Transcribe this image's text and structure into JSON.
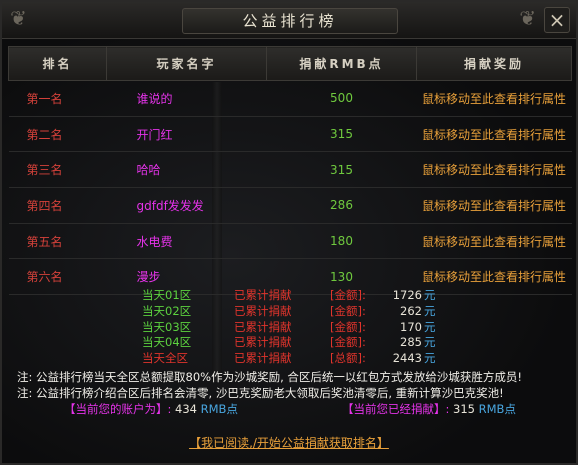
{
  "window": {
    "title": "公益排行榜",
    "close_glyph": "×"
  },
  "table": {
    "headers": [
      "排名",
      "玩家名字",
      "捐献RMB点",
      "捐献奖励"
    ],
    "rows": [
      {
        "rank": "第一名",
        "name": "谁说的",
        "points": "500",
        "reward": "鼠标移动至此查看排行属性"
      },
      {
        "rank": "第二名",
        "name": "开门红",
        "points": "315",
        "reward": "鼠标移动至此查看排行属性"
      },
      {
        "rank": "第三名",
        "name": "哈哈",
        "points": "315",
        "reward": "鼠标移动至此查看排行属性"
      },
      {
        "rank": "第四名",
        "name": "gdfdf发发发",
        "points": "286",
        "reward": "鼠标移动至此查看排行属性"
      },
      {
        "rank": "第五名",
        "name": "水电费",
        "points": "180",
        "reward": "鼠标移动至此查看排行属性"
      },
      {
        "rank": "第六名",
        "name": "漫步",
        "points": "130",
        "reward": "鼠标移动至此查看排行属性"
      }
    ]
  },
  "summary": [
    {
      "day": "当天01区",
      "label": "已累计捐献",
      "amount_label": "[金额]:",
      "value": "1726",
      "unit": "元"
    },
    {
      "day": "当天02区",
      "label": "已累计捐献",
      "amount_label": "[金额]:",
      "value": "262",
      "unit": "元"
    },
    {
      "day": "当天03区",
      "label": "已累计捐献",
      "amount_label": "[金额]:",
      "value": "170",
      "unit": "元"
    },
    {
      "day": "当天04区",
      "label": "已累计捐献",
      "amount_label": "[金额]:",
      "value": "285",
      "unit": "元"
    },
    {
      "day": "当天全区",
      "label": "已累计捐献",
      "amount_label": "[总额]:",
      "value": "2443",
      "unit": "元"
    }
  ],
  "notes": [
    "注: 公益排行榜当天全区总额提取80%作为沙城奖励, 合区后统一以红包方式发放给沙城获胜方成员!",
    "注: 公益排行榜介绍合区后排名会清零, 沙巴克奖励老大领取后奖池清零后, 重新计算沙巴克奖池!"
  ],
  "account": {
    "label": "【当前您的账户为】:",
    "value": "434",
    "unit": "RMB点"
  },
  "donated": {
    "label": "【当前您已经捐献】:",
    "value": "315",
    "unit": "RMB点"
  },
  "action_label": "【我已阅读,/开始公益捐献获取排名】",
  "colors": {
    "rank": "#d4413a",
    "name": "#e533e9",
    "points": "#6fc93e",
    "reward": "#e8a03a",
    "unit": "#49a6e0"
  }
}
